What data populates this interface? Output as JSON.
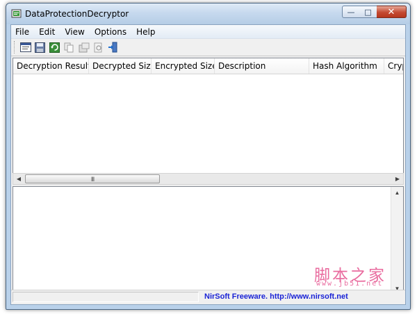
{
  "window": {
    "title": "DataProtectionDecryptor",
    "minimize_glyph": "—",
    "maximize_glyph": "□",
    "close_glyph": "✕"
  },
  "menu": [
    {
      "label": "File"
    },
    {
      "label": "Edit"
    },
    {
      "label": "View"
    },
    {
      "label": "Options"
    },
    {
      "label": "Help"
    }
  ],
  "toolbar": [
    {
      "icon": "properties-icon"
    },
    {
      "icon": "save-icon"
    },
    {
      "icon": "refresh-icon"
    },
    {
      "icon": "copy-icon"
    },
    {
      "icon": "html-report-icon"
    },
    {
      "icon": "find-icon"
    },
    {
      "icon": "exit-icon"
    }
  ],
  "table": {
    "columns": [
      {
        "label": "Decryption Result"
      },
      {
        "label": "Decrypted Size"
      },
      {
        "label": "Encrypted Size"
      },
      {
        "label": "Description"
      },
      {
        "label": "Hash Algorithm"
      },
      {
        "label": "Cryp"
      }
    ],
    "rows": []
  },
  "hscroll": {
    "thumb_grip": "III"
  },
  "statusbar": {
    "link_text": "NirSoft Freeware.  http://www.nirsoft.net"
  },
  "watermark": {
    "cn": "脚本之家",
    "url": "www.jb51.net"
  },
  "colors": {
    "link": "#1a23d6",
    "watermark": "#e96c9f",
    "close_button": "#c44a32"
  }
}
